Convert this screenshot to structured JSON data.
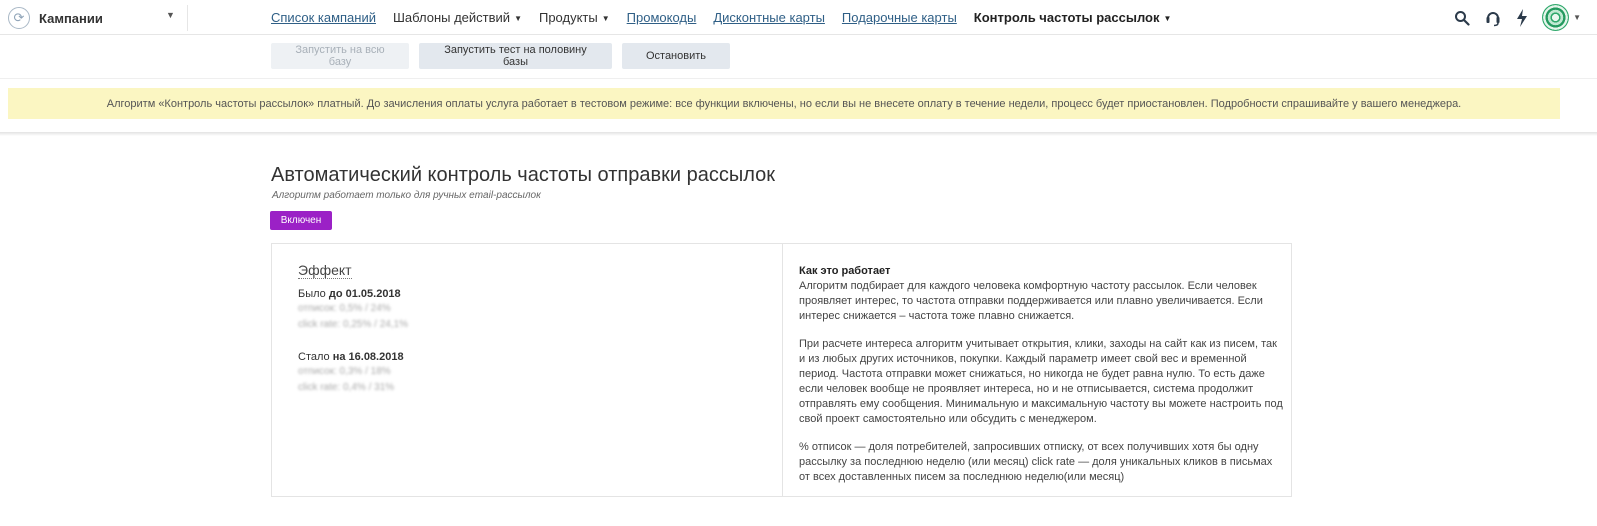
{
  "app": {
    "brand_icon": "rotate-arrows-icon",
    "brand_name": "Кампании"
  },
  "nav": {
    "items": [
      {
        "label": "Список кампаний"
      },
      {
        "label": "Шаблоны действий"
      },
      {
        "label": "Продукты"
      },
      {
        "label": "Промокоды"
      },
      {
        "label": "Дисконтные карты"
      },
      {
        "label": "Подарочные карты"
      },
      {
        "label": "Контроль частоты рассылок"
      }
    ]
  },
  "tools": {
    "search_icon": "search-icon",
    "support_icon": "headset-icon",
    "lightning_icon": "lightning-icon"
  },
  "actions": {
    "run_all": "Запустить на всю базу",
    "run_half": "Запустить тест на половину базы",
    "stop": "Остановить"
  },
  "notice": {
    "text": "Алгоритм «Контроль частоты рассылок» платный. До зачисления оплаты услуга работает в тестовом режиме: все функции включены, но если вы не внесете оплату в течение недели, процесс будет приостановлен. Подробности спрашивайте у вашего менеджера."
  },
  "page": {
    "title": "Автоматический контроль частоты отправки рассылок",
    "subtitle": "Алгоритм работает только для ручных email-рассылок",
    "status_badge": "Включен"
  },
  "effect": {
    "title": "Эффект",
    "before_prefix": "Было",
    "before_date": "до 01.05.2018",
    "before_unsub": "отписок: 0,5% / 24%",
    "before_click": "click rate: 0,25% / 24,1%",
    "after_prefix": "Стало",
    "after_date": "на 16.08.2018",
    "after_unsub": "отписок: 0,3% / 18%",
    "after_click": "click rate: 0,4% / 31%"
  },
  "how": {
    "title": "Как это работает",
    "p1": "Алгоритм подбирает для каждого человека комфортную частоту рассылок. Если человек проявляет интерес, то частота отправки поддерживается или плавно увеличивается. Если интерес снижается – частота тоже плавно снижается.",
    "p2": "При расчете интереса алгоритм учитывает открытия, клики, заходы на сайт как из писем, так и из любых других источников, покупки. Каждый параметр имеет свой вес и временной период. Частота отправки может снижаться, но никогда не будет равна нулю. То есть даже если человек вообще не проявляет интереса, но и не отписывается, система продолжит отправлять ему сообщения. Минимальную и максимальную частоту вы можете настроить под свой проект самостоятельно или обсудить с менеджером.",
    "p3": "% отписок — доля потребителей, запросивших отписку, от всех получивших хотя бы одну рассылку за последнюю неделю (или месяц) click rate — доля уникальных кликов в письмах от всех доставленных писем за последнюю неделю(или месяц)"
  },
  "colors": {
    "accent": "#9b21c6",
    "notice_bg": "#fbf6c2",
    "link": "#2f5f86"
  }
}
